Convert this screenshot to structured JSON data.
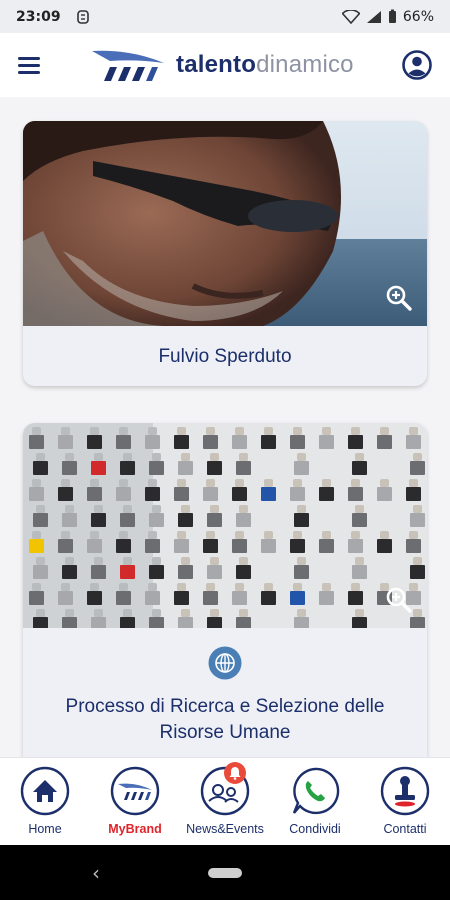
{
  "status": {
    "time": "23:09",
    "battery": "66%",
    "icons": [
      "sync-icon",
      "wifi-icon",
      "signal-icon",
      "battery-icon"
    ]
  },
  "header": {
    "logo_part1": "talento",
    "logo_part2": "dinamico",
    "menu_icon": "hamburger-menu-icon",
    "account_icon": "account-circle-icon"
  },
  "cards": [
    {
      "title": "Fulvio Sperduto",
      "zoom_icon": "zoom-in-icon"
    },
    {
      "title": "Processo di Ricerca e Selezione delle Risorse Umane",
      "zoom_icon": "zoom-in-icon",
      "link_icon": "globe-icon"
    }
  ],
  "bottom_nav": {
    "items": [
      {
        "label": "Home",
        "icon": "home-icon",
        "active": false
      },
      {
        "label": "MyBrand",
        "icon": "brand-logo-icon",
        "active": true
      },
      {
        "label": "News&Events",
        "icon": "news-events-icon",
        "active": false
      },
      {
        "label": "Condividi",
        "icon": "whatsapp-icon",
        "active": false
      },
      {
        "label": "Contatti",
        "icon": "contacts-stamp-icon",
        "active": false
      }
    ]
  },
  "colors": {
    "brand_navy": "#1c2f6b",
    "brand_gray": "#8d93a3",
    "active_red": "#e0242a",
    "badge_red": "#e84b3c"
  }
}
